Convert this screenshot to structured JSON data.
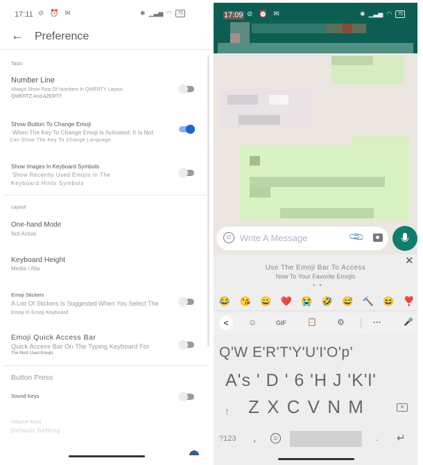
{
  "left": {
    "status": {
      "time": "17:11",
      "left_icons": "⊘ ⏰ ✉",
      "right_icons": [
        "bluetooth-icon",
        "signal-icon",
        "wifi-icon"
      ],
      "battery": "75"
    },
    "app_bar": {
      "back_icon": "←",
      "title": "Preference"
    },
    "sections": {
      "tasty": "Tastv",
      "layout": "Layout",
      "button_press": "Button Press"
    },
    "items": [
      {
        "title": "Number Line",
        "subtitle1": "Always Show Row Of Numbers In QWERTY Layout.",
        "subtitle2": "QWERTZ And AZERTY",
        "toggle": false
      },
      {
        "title": "Show Button To Change Emoji",
        "subtitle1": "When The Key To Change Emoji Is Activated. It Is Not",
        "subtitle2": "Can Show The Key To Change Language",
        "toggle": true
      },
      {
        "title": "Show Images In Keyboard Symbols",
        "subtitle1": "Show Recently Used Emojis In The",
        "subtitle2": "Keyboard Hints Symbols",
        "toggle": false
      },
      {
        "title": "One-hand Mode",
        "subtitle1": "Not Active"
      },
      {
        "title": "Keyboard Height",
        "subtitle1": "Media / Alia"
      },
      {
        "title": "Emoji Stickers",
        "subtitle1": "A List Of Stickers Is Suggested When You Select The",
        "subtitle2": "Emoji In Emoji Keyboard",
        "toggle": false
      },
      {
        "title": "Emoji Quick Access Bar",
        "subtitle1": "Quick Access Bar On The Typing Keyboard For",
        "subtitle2": "The Most Used Emojis.",
        "toggle": false
      },
      {
        "title": "Sound Keys",
        "toggle": false
      },
      {
        "title": "Volume Keys",
        "subtitle1": "Default Setting."
      }
    ]
  },
  "right": {
    "status": {
      "time": "17:09",
      "left_icons": "⊘ ⏰ ✉",
      "battery": "75"
    },
    "input": {
      "placeholder": "Write A Message"
    },
    "emoji_bar": {
      "close": "✕",
      "tip_line1": "Use The Emoji Bar To Access",
      "tip_line2": "Now To Your Favorite Emojis",
      "emojis": [
        "😂",
        "😘",
        "😀",
        "❤️",
        "😭",
        "🤣",
        "😅",
        "🔨",
        "😆",
        "❣️"
      ]
    },
    "toolbar": {
      "back": "<",
      "sticker": "☺",
      "gif": "GIF",
      "clipboard": "📋",
      "settings": "⚙",
      "more": "···",
      "mic": "🎤"
    },
    "keys": {
      "row1": "Q'W E'R'T'Y'U'I'O'p'",
      "row2": "A's ' D ' 6 'H J 'K'l'",
      "row3": "Z X C V N M",
      "symbols": "?123",
      "comma": ",",
      "emoji": "☺",
      "period": ".",
      "enter": "↵",
      "shift": "↑",
      "backspace": "✕"
    }
  }
}
